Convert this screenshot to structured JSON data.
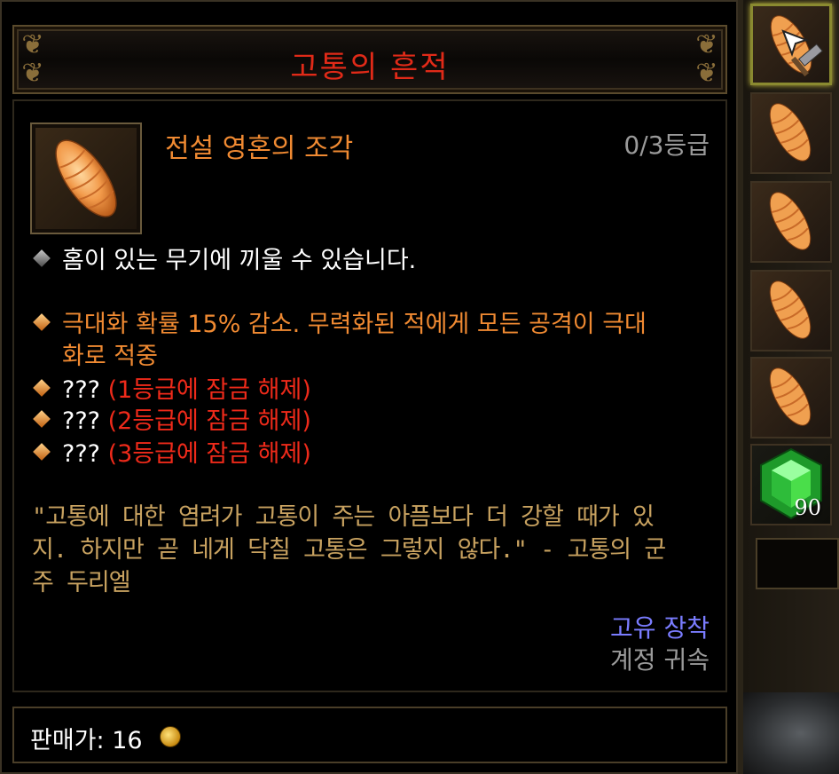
{
  "tooltip": {
    "title": "고통의 흔적",
    "item_name": "전설 영혼의 조각",
    "grade": "0/3등급",
    "properties": [
      {
        "text": "홈이 있는 무기에 끼울 수 있습니다.",
        "color": "#ffffff",
        "bullet": "grey"
      },
      {
        "text": "극대화 확률 15% 감소. 무력화된 적에게 모든 공격이 극대",
        "color": "#f08a32",
        "bullet": "orange"
      },
      {
        "text": "화로 적중",
        "color": "#f08a32",
        "bullet": "none"
      },
      {
        "prefix": "???",
        "text": "(1등급에 잠금 해제)",
        "color": "#ee2a1a",
        "bullet": "orange"
      },
      {
        "prefix": "???",
        "text": "(2등급에 잠금 해제)",
        "color": "#ee2a1a",
        "bullet": "orange"
      },
      {
        "prefix": "???",
        "text": "(3등급에 잠금 해제)",
        "color": "#ee2a1a",
        "bullet": "orange"
      }
    ],
    "flavor_lines": [
      "\"고통에 대한 염려가 고통이 주는 아픔보다 더 강할 때가 있",
      "지. 하지만 곧 네게 닥칠 고통은 그렇지 않다.\" - 고통의 군",
      "주 두리엘"
    ],
    "binding": "고유 장착",
    "account": "계정 귀속",
    "price_label": "판매가: 16"
  },
  "sidebar": {
    "gem_count": "90",
    "slot_icon": "soul-shard-icon",
    "gem_icon": "emerald-gem-icon"
  },
  "colors": {
    "title": "#e02a18",
    "legendary": "#f08a32",
    "locked": "#ee2a1a",
    "flavor": "#c8a260",
    "binding": "#7a7cff",
    "grey": "#9a9a9a"
  }
}
